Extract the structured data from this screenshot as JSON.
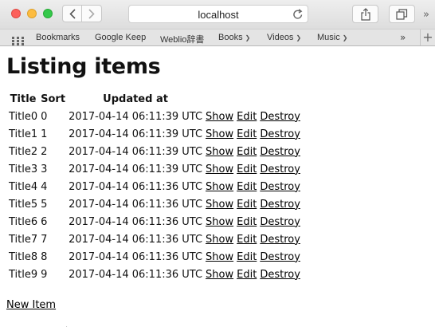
{
  "browser": {
    "address": "localhost",
    "bookmarks": [
      {
        "label": "Bookmarks",
        "menu": false
      },
      {
        "label": "Google Keep",
        "menu": false
      },
      {
        "label": "Weblio辞書",
        "menu": false
      },
      {
        "label": "Books",
        "menu": true
      },
      {
        "label": "Videos",
        "menu": true
      },
      {
        "label": "Music",
        "menu": true
      }
    ],
    "overflow_label": "»",
    "add_label": "+"
  },
  "page": {
    "title": "Listing items",
    "columns": [
      "Title",
      "Sort",
      "Updated at"
    ],
    "rows": [
      {
        "title": "Title0",
        "sort": "0",
        "updated_at": "2017-04-14 06:11:39 UTC"
      },
      {
        "title": "Title1",
        "sort": "1",
        "updated_at": "2017-04-14 06:11:39 UTC"
      },
      {
        "title": "Title2",
        "sort": "2",
        "updated_at": "2017-04-14 06:11:39 UTC"
      },
      {
        "title": "Title3",
        "sort": "3",
        "updated_at": "2017-04-14 06:11:39 UTC"
      },
      {
        "title": "Title4",
        "sort": "4",
        "updated_at": "2017-04-14 06:11:36 UTC"
      },
      {
        "title": "Title5",
        "sort": "5",
        "updated_at": "2017-04-14 06:11:36 UTC"
      },
      {
        "title": "Title6",
        "sort": "6",
        "updated_at": "2017-04-14 06:11:36 UTC"
      },
      {
        "title": "Title7",
        "sort": "7",
        "updated_at": "2017-04-14 06:11:36 UTC"
      },
      {
        "title": "Title8",
        "sort": "8",
        "updated_at": "2017-04-14 06:11:36 UTC"
      },
      {
        "title": "Title9",
        "sort": "9",
        "updated_at": "2017-04-14 06:11:36 UTC"
      }
    ],
    "row_actions": {
      "show": "Show",
      "edit": "Edit",
      "destroy": "Destroy"
    },
    "new_item_label": "New Item"
  }
}
